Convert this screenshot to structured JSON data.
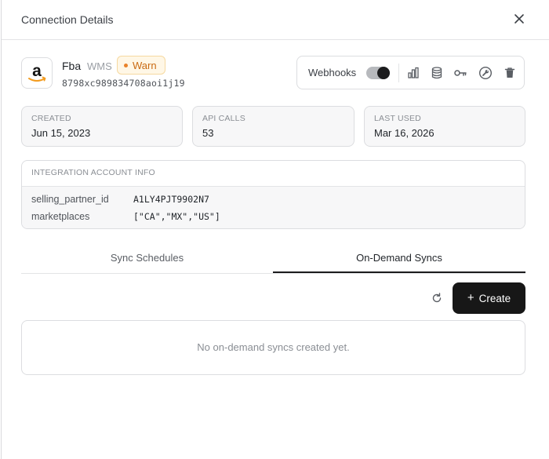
{
  "header": {
    "title": "Connection Details",
    "close_icon": "close-icon"
  },
  "account": {
    "logo_icon": "amazon-logo-icon",
    "name": "Fba",
    "type": "WMS",
    "status": "Warn",
    "status_color": "#e9822a",
    "id": "8798xc989834708aoi1j19"
  },
  "toolbar": {
    "webhooks_label": "Webhooks",
    "webhooks_enabled": true,
    "icons": [
      "bar-chart-icon",
      "database-icon",
      "key-icon",
      "wrench-icon",
      "trash-icon"
    ]
  },
  "stats": [
    {
      "label": "CREATED",
      "value": "Jun 15, 2023"
    },
    {
      "label": "API CALLS",
      "value": "53"
    },
    {
      "label": "LAST USED",
      "value": "Mar 16, 2026"
    }
  ],
  "integration_info": {
    "title": "INTEGRATION ACCOUNT INFO",
    "rows": [
      {
        "key": "selling_partner_id",
        "value": "A1LY4PJT9902N7"
      },
      {
        "key": "marketplaces",
        "value": "[\"CA\",\"MX\",\"US\"]"
      }
    ]
  },
  "tabs": [
    {
      "label": "Sync Schedules",
      "active": false
    },
    {
      "label": "On-Demand Syncs",
      "active": true
    }
  ],
  "actions": {
    "refresh_icon": "refresh-icon",
    "create_label": "Create"
  },
  "empty_state": {
    "message": "No on-demand syncs created yet."
  },
  "colors": {
    "accent": "#171717",
    "warn_text": "#c96a12",
    "warn_bg": "#fff7e6"
  }
}
